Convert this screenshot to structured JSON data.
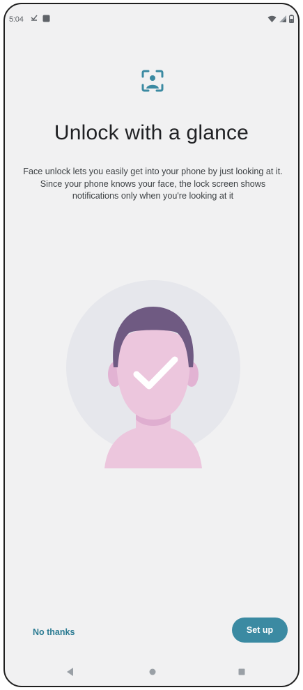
{
  "status_bar": {
    "time": "5:04",
    "icons": [
      "download-done-icon",
      "app-notification-icon",
      "wifi-icon",
      "signal-icon",
      "battery-icon"
    ]
  },
  "header": {
    "icon": "face-scan-icon",
    "title": "Unlock with a glance",
    "description": "Face unlock lets you easily get into your phone by just looking at it. Since your phone knows your face, the lock screen shows notifications only when you're looking at it"
  },
  "illustration": {
    "icon": "face-checkmark-illustration"
  },
  "actions": {
    "secondary_label": "No thanks",
    "primary_label": "Set up"
  },
  "navigation": [
    "back-icon",
    "home-icon",
    "recents-icon"
  ],
  "colors": {
    "accent": "#2d7c93",
    "button": "#3b8aa2",
    "background": "#f1f1f2",
    "hair": "#6f5a82",
    "skin": "#ecc6dd",
    "circle": "#e6e7ec"
  }
}
